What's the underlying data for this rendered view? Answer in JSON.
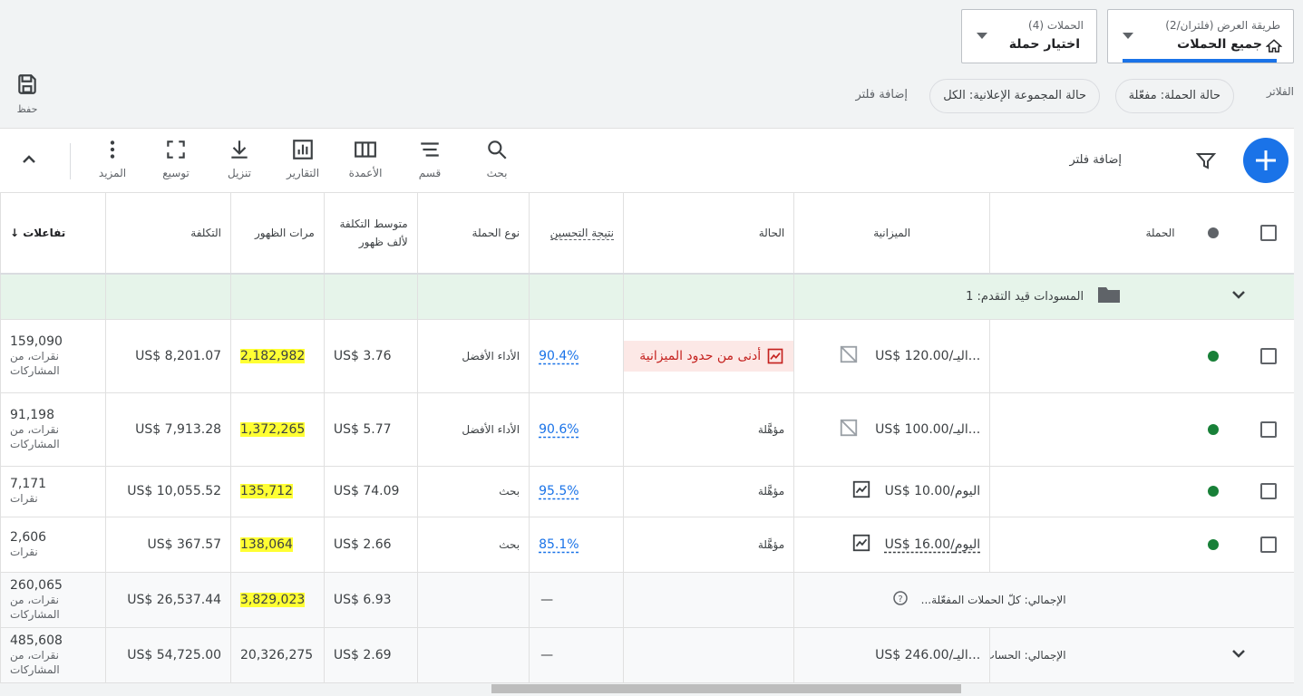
{
  "header": {
    "view_label": "طريقة العرض (فلتران/2)",
    "view_value": "جميع الحملات",
    "campaigns_label": "الحملات (4)",
    "campaigns_value": "اختيار حملة"
  },
  "save": {
    "label": "حفظ"
  },
  "filters": {
    "label": "الفلاتر",
    "chips": [
      "حالة الحملة: مفعّلة",
      "حالة المجموعة الإعلانية: الكل"
    ],
    "add": "إضافة فلتر"
  },
  "toolbar": {
    "add_filter": "إضافة فلتر",
    "buttons": [
      "بحث",
      "قسم",
      "الأعمدة",
      "التقارير",
      "تنزيل",
      "توسيع",
      "المزيد"
    ]
  },
  "columns": {
    "campaign": "الحملة",
    "budget": "الميزانية",
    "status": "الحالة",
    "opt_score": "نتيجة التحسين",
    "type": "نوع الحملة",
    "avg_cpm": "متوسط التكلفة لألف ظهور",
    "impressions": "مرات الظهور",
    "cost": "التكلفة",
    "interactions": "تفاعلات"
  },
  "drafts": {
    "label": "المسودات قيد التقدم: 1"
  },
  "rows": [
    {
      "budget": "US$ 120.00/اليـ...",
      "status": "أدنى من حدود الميزانية",
      "opt": "90.4%",
      "type": "الأداء الأفضل",
      "cpm": "US$ 3.76",
      "impr": "2,182,982",
      "cost": "US$ 8,201.07",
      "inter": "159,090",
      "inter_unit": "نقرات، من المشاركات"
    },
    {
      "budget": "US$ 100.00/اليـ...",
      "status": "مؤهَّلة",
      "opt": "90.6%",
      "type": "الأداء الأفضل",
      "cpm": "US$ 5.77",
      "impr": "1,372,265",
      "cost": "US$ 7,913.28",
      "inter": "91,198",
      "inter_unit": "نقرات، من المشاركات"
    },
    {
      "budget": "US$ 10.00/اليوم",
      "status": "مؤهَّلة",
      "opt": "95.5%",
      "type": "بحث",
      "cpm": "US$ 74.09",
      "impr": "135,712",
      "cost": "US$ 10,055.52",
      "inter": "7,171",
      "inter_unit": "نقرات"
    },
    {
      "budget": "US$ 16.00/اليوم",
      "status": "مؤهَّلة",
      "opt": "85.1%",
      "type": "بحث",
      "cpm": "US$ 2.66",
      "impr": "138,064",
      "cost": "US$ 367.57",
      "inter": "2,606",
      "inter_unit": "نقرات"
    }
  ],
  "total_enabled": {
    "label": "الإجمالي: كلّ الحملات المفعّلة...",
    "opt": "—",
    "cpm": "US$ 6.93",
    "impr": "3,829,023",
    "cost": "US$ 26,537.44",
    "inter": "260,065",
    "inter_unit": "نقرات، من المشاركات"
  },
  "total_account": {
    "label": "الإجمالي: الحساب",
    "budget": "US$ 246.00/اليـ...",
    "opt": "—",
    "cpm": "US$ 2.69",
    "impr": "20,326,275",
    "cost": "US$ 54,725.00",
    "inter": "485,608",
    "inter_unit": "نقرات، من المشاركات"
  },
  "colors": {
    "accent": "#1a73e8",
    "enabled": "#188038",
    "highlight": "#ffff33",
    "limited_bg": "#fce8e6",
    "limited_text": "#c5221f"
  }
}
